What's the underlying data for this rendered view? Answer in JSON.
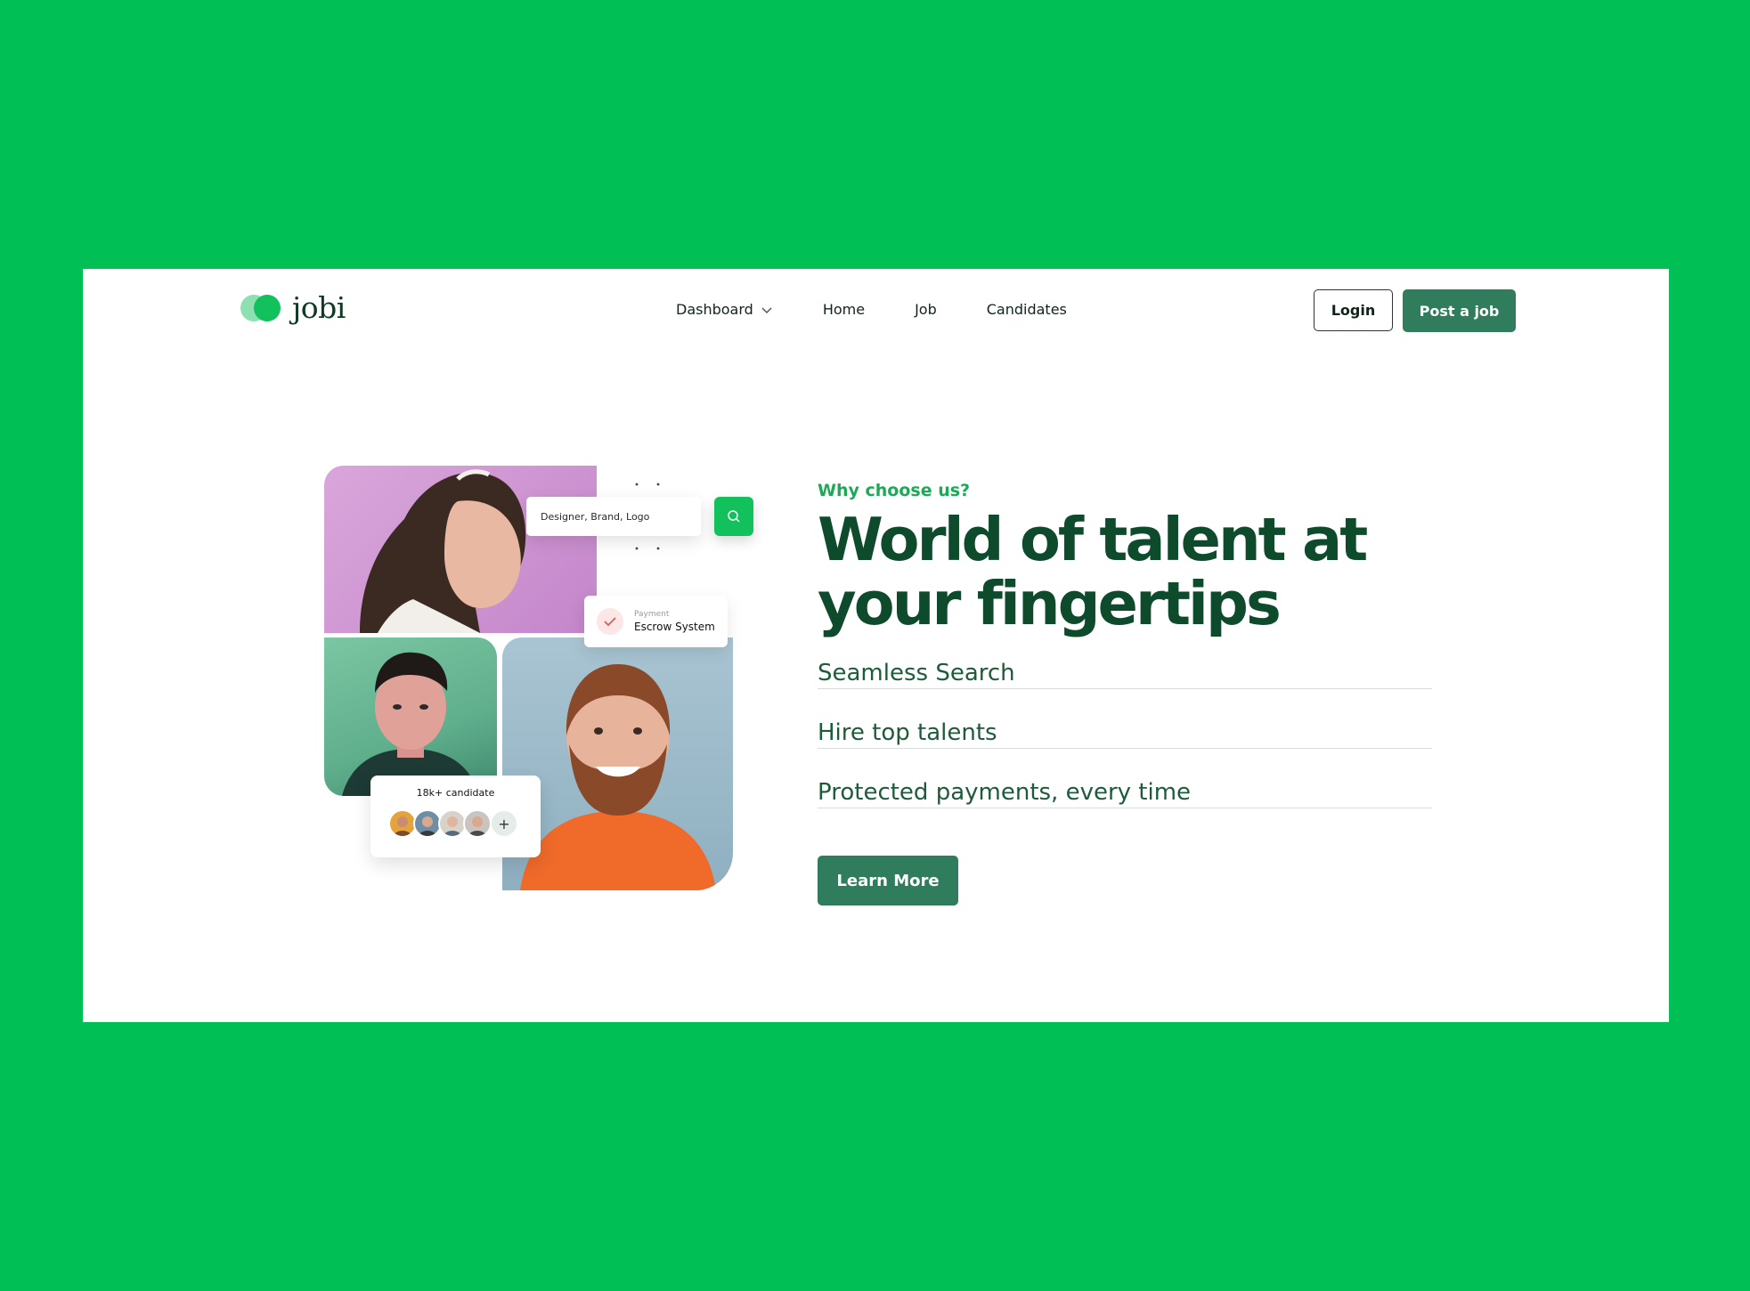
{
  "brand": {
    "name": "jobi"
  },
  "nav": {
    "items": [
      {
        "label": "Dashboard",
        "has_dropdown": true
      },
      {
        "label": "Home"
      },
      {
        "label": "Job"
      },
      {
        "label": "Candidates"
      }
    ],
    "login_label": "Login",
    "post_job_label": "Post a job"
  },
  "collage": {
    "search_text": "Designer, Brand, Logo",
    "escrow_caption": "Payment",
    "escrow_title": "Escrow System",
    "candidates_label": "18k+ candidate",
    "more_symbol": "+"
  },
  "hero": {
    "eyebrow": "Why choose us?",
    "headline": "World of talent at your fingertips",
    "features": [
      "Seamless Search",
      "Hire top talents",
      "Protected payments, every time"
    ],
    "cta_label": "Learn More"
  },
  "colors": {
    "background": "#00BF55",
    "primary_button": "#2F7D5C",
    "headline": "#0E4A2C",
    "accent": "#12C15C"
  }
}
